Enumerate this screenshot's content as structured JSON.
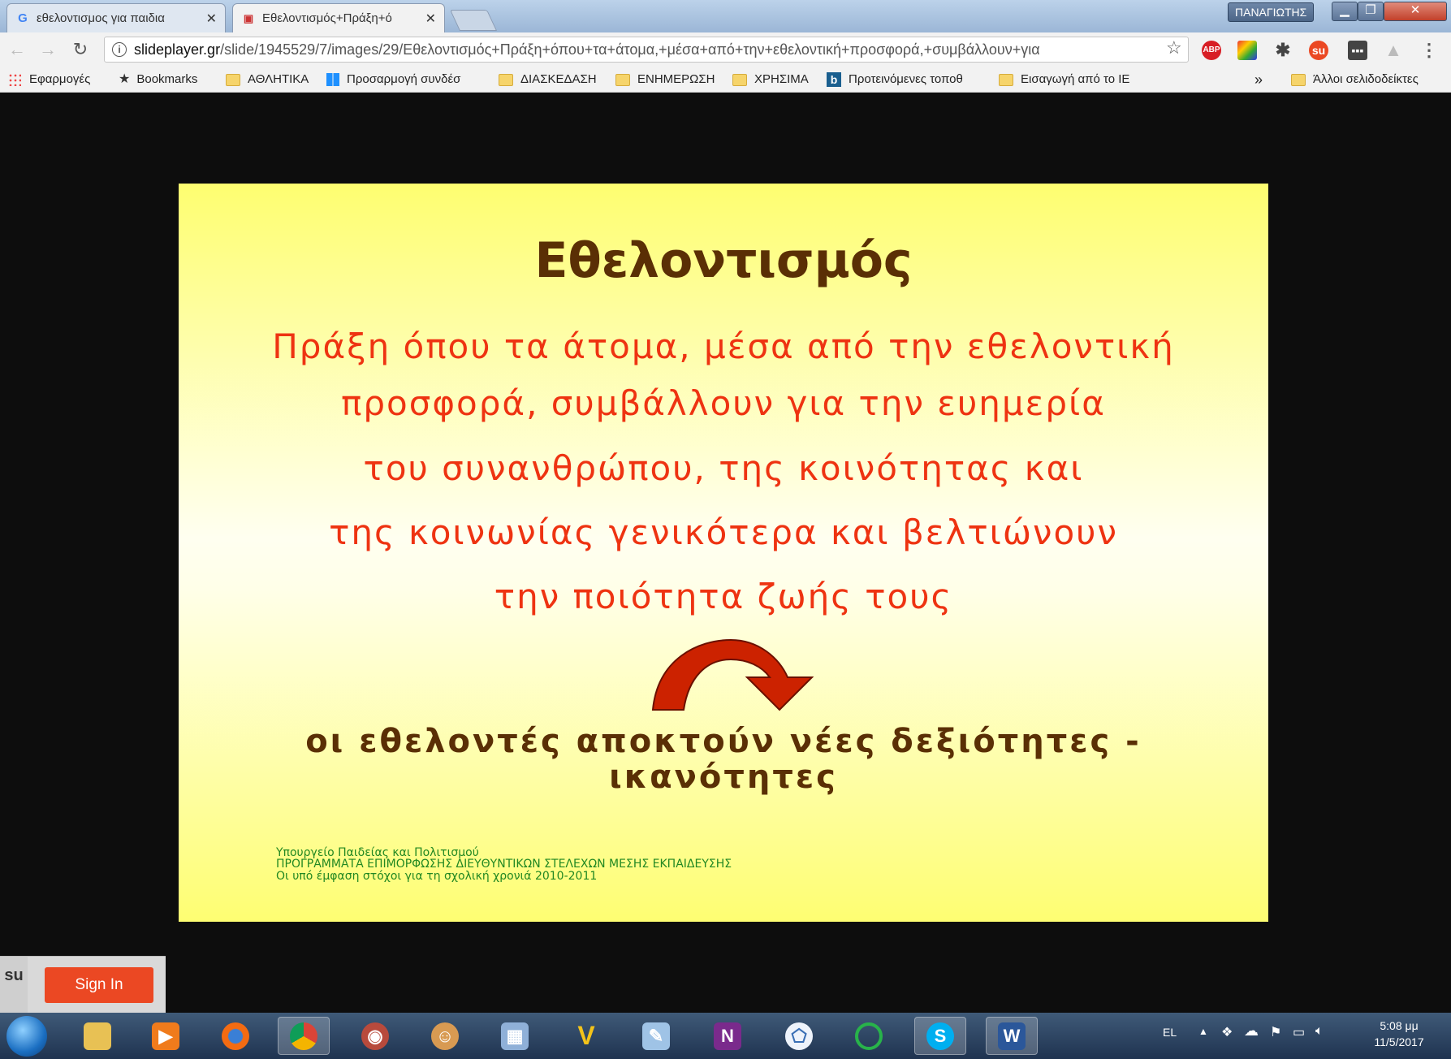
{
  "tabs": [
    {
      "label": "εθελοντισμος για παιδια",
      "icon": "google-icon"
    },
    {
      "label": "Εθελοντισμός+Πράξη+ό",
      "icon": "slideplayer-icon"
    }
  ],
  "window": {
    "user_badge": "ΠΑΝΑΓΙΩΤΗΣ"
  },
  "address_bar": {
    "host": "slideplayer.gr",
    "path": "/slide/1945529/7/images/29/Εθελοντισμός+Πράξη+όπου+τα+άτομα,+μέσα+από+την+εθελοντική+προσφορά,+συμβάλλουν+για"
  },
  "extensions": [
    "ABP",
    "colorful-icon",
    "spider-icon",
    "stumbleupon-icon",
    "more-icon",
    "drive-icon"
  ],
  "bookmarks": [
    {
      "label": "Εφαρμογές",
      "icon": "apps-icon"
    },
    {
      "label": "Bookmarks",
      "icon": "star-icon"
    },
    {
      "label": "ΑΘΛΗΤΙΚΑ",
      "icon": "folder-icon"
    },
    {
      "label": "Προσαρμογή συνδέσ",
      "icon": "windows-icon"
    },
    {
      "label": "ΔΙΑΣΚΕΔΑΣΗ",
      "icon": "folder-icon"
    },
    {
      "label": "ΕΝΗΜΕΡΩΣΗ",
      "icon": "folder-icon"
    },
    {
      "label": "ΧΡΗΣΙΜΑ",
      "icon": "folder-icon"
    },
    {
      "label": "Προτεινόμενες τοποθ",
      "icon": "bing-icon"
    },
    {
      "label": "Εισαγωγή από το IE",
      "icon": "folder-icon"
    }
  ],
  "bookmarks_overflow": "»",
  "other_bookmarks": "Άλλοι σελιδοδείκτες",
  "slide": {
    "title": "Εθελοντισμός",
    "lines": [
      "Πράξη όπου τα άτομα, μέσα από την εθελοντική",
      "προσφορά, συμβάλλουν για την ευημερία",
      "του συνανθρώπου, της κοινότητας και",
      "της κοινωνίας γενικότερα και βελτιώνουν",
      "την ποιότητα ζωής τους"
    ],
    "conclusion": [
      "οι εθελοντές αποκτούν νέες δεξιότητες -",
      "ικανότητες"
    ],
    "footer": [
      "Υπουργείο Παιδείας και Πολιτισμού",
      "ΠΡΟΓΡΑΜΜΑΤΑ ΕΠΙΜΟΡΦΩΣΗΣ ΔΙΕΥΘΥΝΤΙΚΩΝ ΣΤΕΛΕΧΩΝ ΜΕΣΗΣ ΕΚΠΑΙΔΕΥΣΗΣ",
      "Οι υπό έμφαση στόχοι για τη σχολική χρονιά 2010-2011"
    ],
    "colors": {
      "title": "#5a2f05",
      "text": "#ee3311",
      "arrow": "#cc2200",
      "footer": "#228822"
    }
  },
  "stumbleupon": {
    "sign_in": "Sign In"
  },
  "taskbar": {
    "apps": [
      "explorer-icon",
      "media-player-icon",
      "firefox-icon",
      "chrome-icon",
      "photo-viewer-icon",
      "game-icon",
      "calculator-icon",
      "vector-icon",
      "scanner-icon",
      "onenote-icon",
      "network-icon",
      "opera-icon",
      "skype-icon",
      "word-icon"
    ]
  },
  "tray": {
    "language": "EL",
    "time": "5:08 μμ",
    "date": "11/5/2017"
  }
}
